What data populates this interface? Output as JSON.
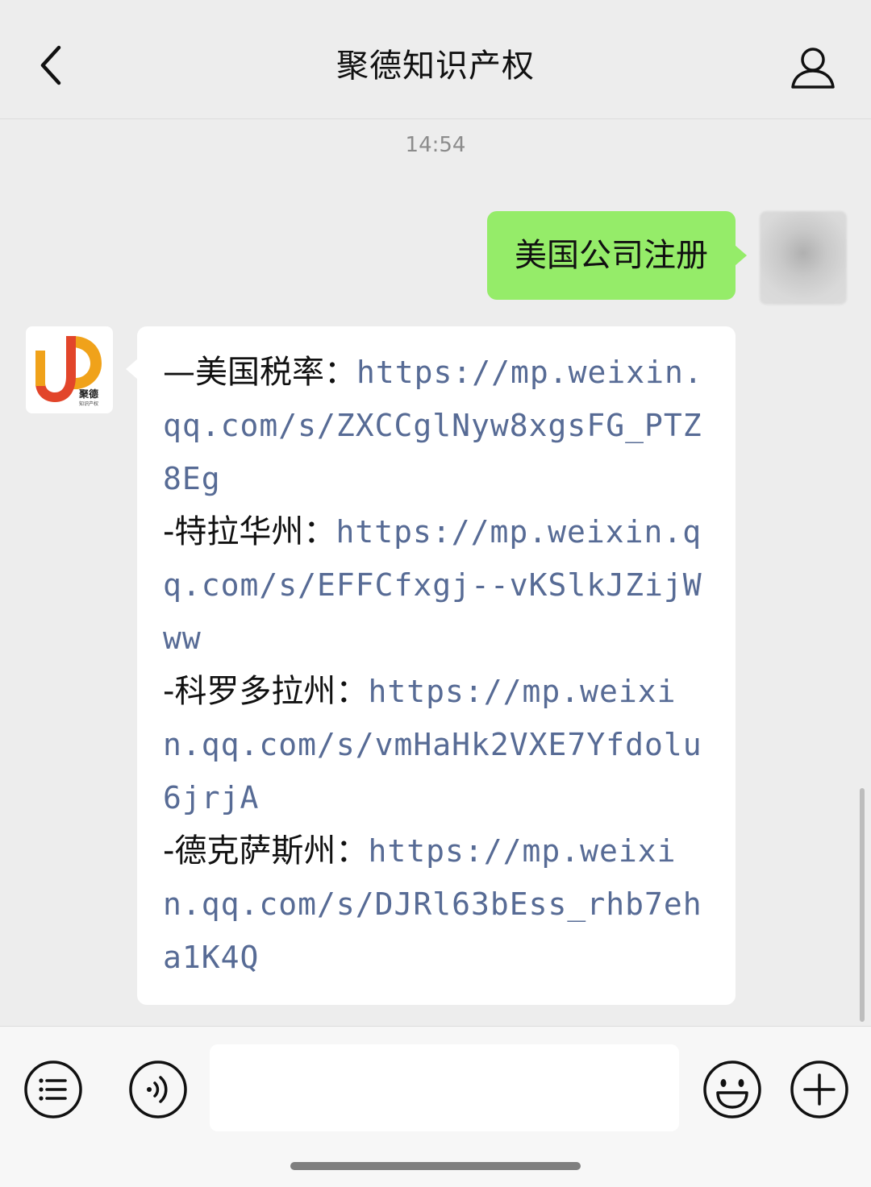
{
  "header": {
    "title": "聚德知识产权",
    "back_icon": "chevron-left-icon",
    "profile_icon": "person-icon"
  },
  "chat": {
    "timestamp": "14:54",
    "outgoing_message": "美国公司注册",
    "incoming_entries": [
      {
        "label": "—美国税率：",
        "link": "https://mp.weixin.qq.com/s/ZXCCglNyw8xgsFG_PTZ8Eg"
      },
      {
        "label": "-特拉华州：",
        "link": "https://mp.weixin.qq.com/s/EFFCfxgj--vKSlkJZijWww"
      },
      {
        "label": "-科罗多拉州：",
        "link": "https://mp.weixin.qq.com/s/vmHaHk2VXE7Yfdolu6jrjA"
      },
      {
        "label": "-德克萨斯州：",
        "link": "https://mp.weixin.qq.com/s/DJRl63bEss_rhb7eha1K4Q"
      }
    ],
    "brand_avatar": {
      "letters": "JD",
      "caption": "聚德",
      "subcaption": "知识产权"
    }
  },
  "input_bar": {
    "menu_icon": "list-menu-icon",
    "voice_icon": "voice-icon",
    "emoji_icon": "emoji-icon",
    "plus_icon": "plus-icon",
    "placeholder": ""
  },
  "colors": {
    "background": "#ededed",
    "outgoing_bubble": "#95ec69",
    "incoming_bubble": "#ffffff",
    "link": "#576b95",
    "brand_orange": "#f0a21a",
    "brand_red": "#e2452a"
  }
}
